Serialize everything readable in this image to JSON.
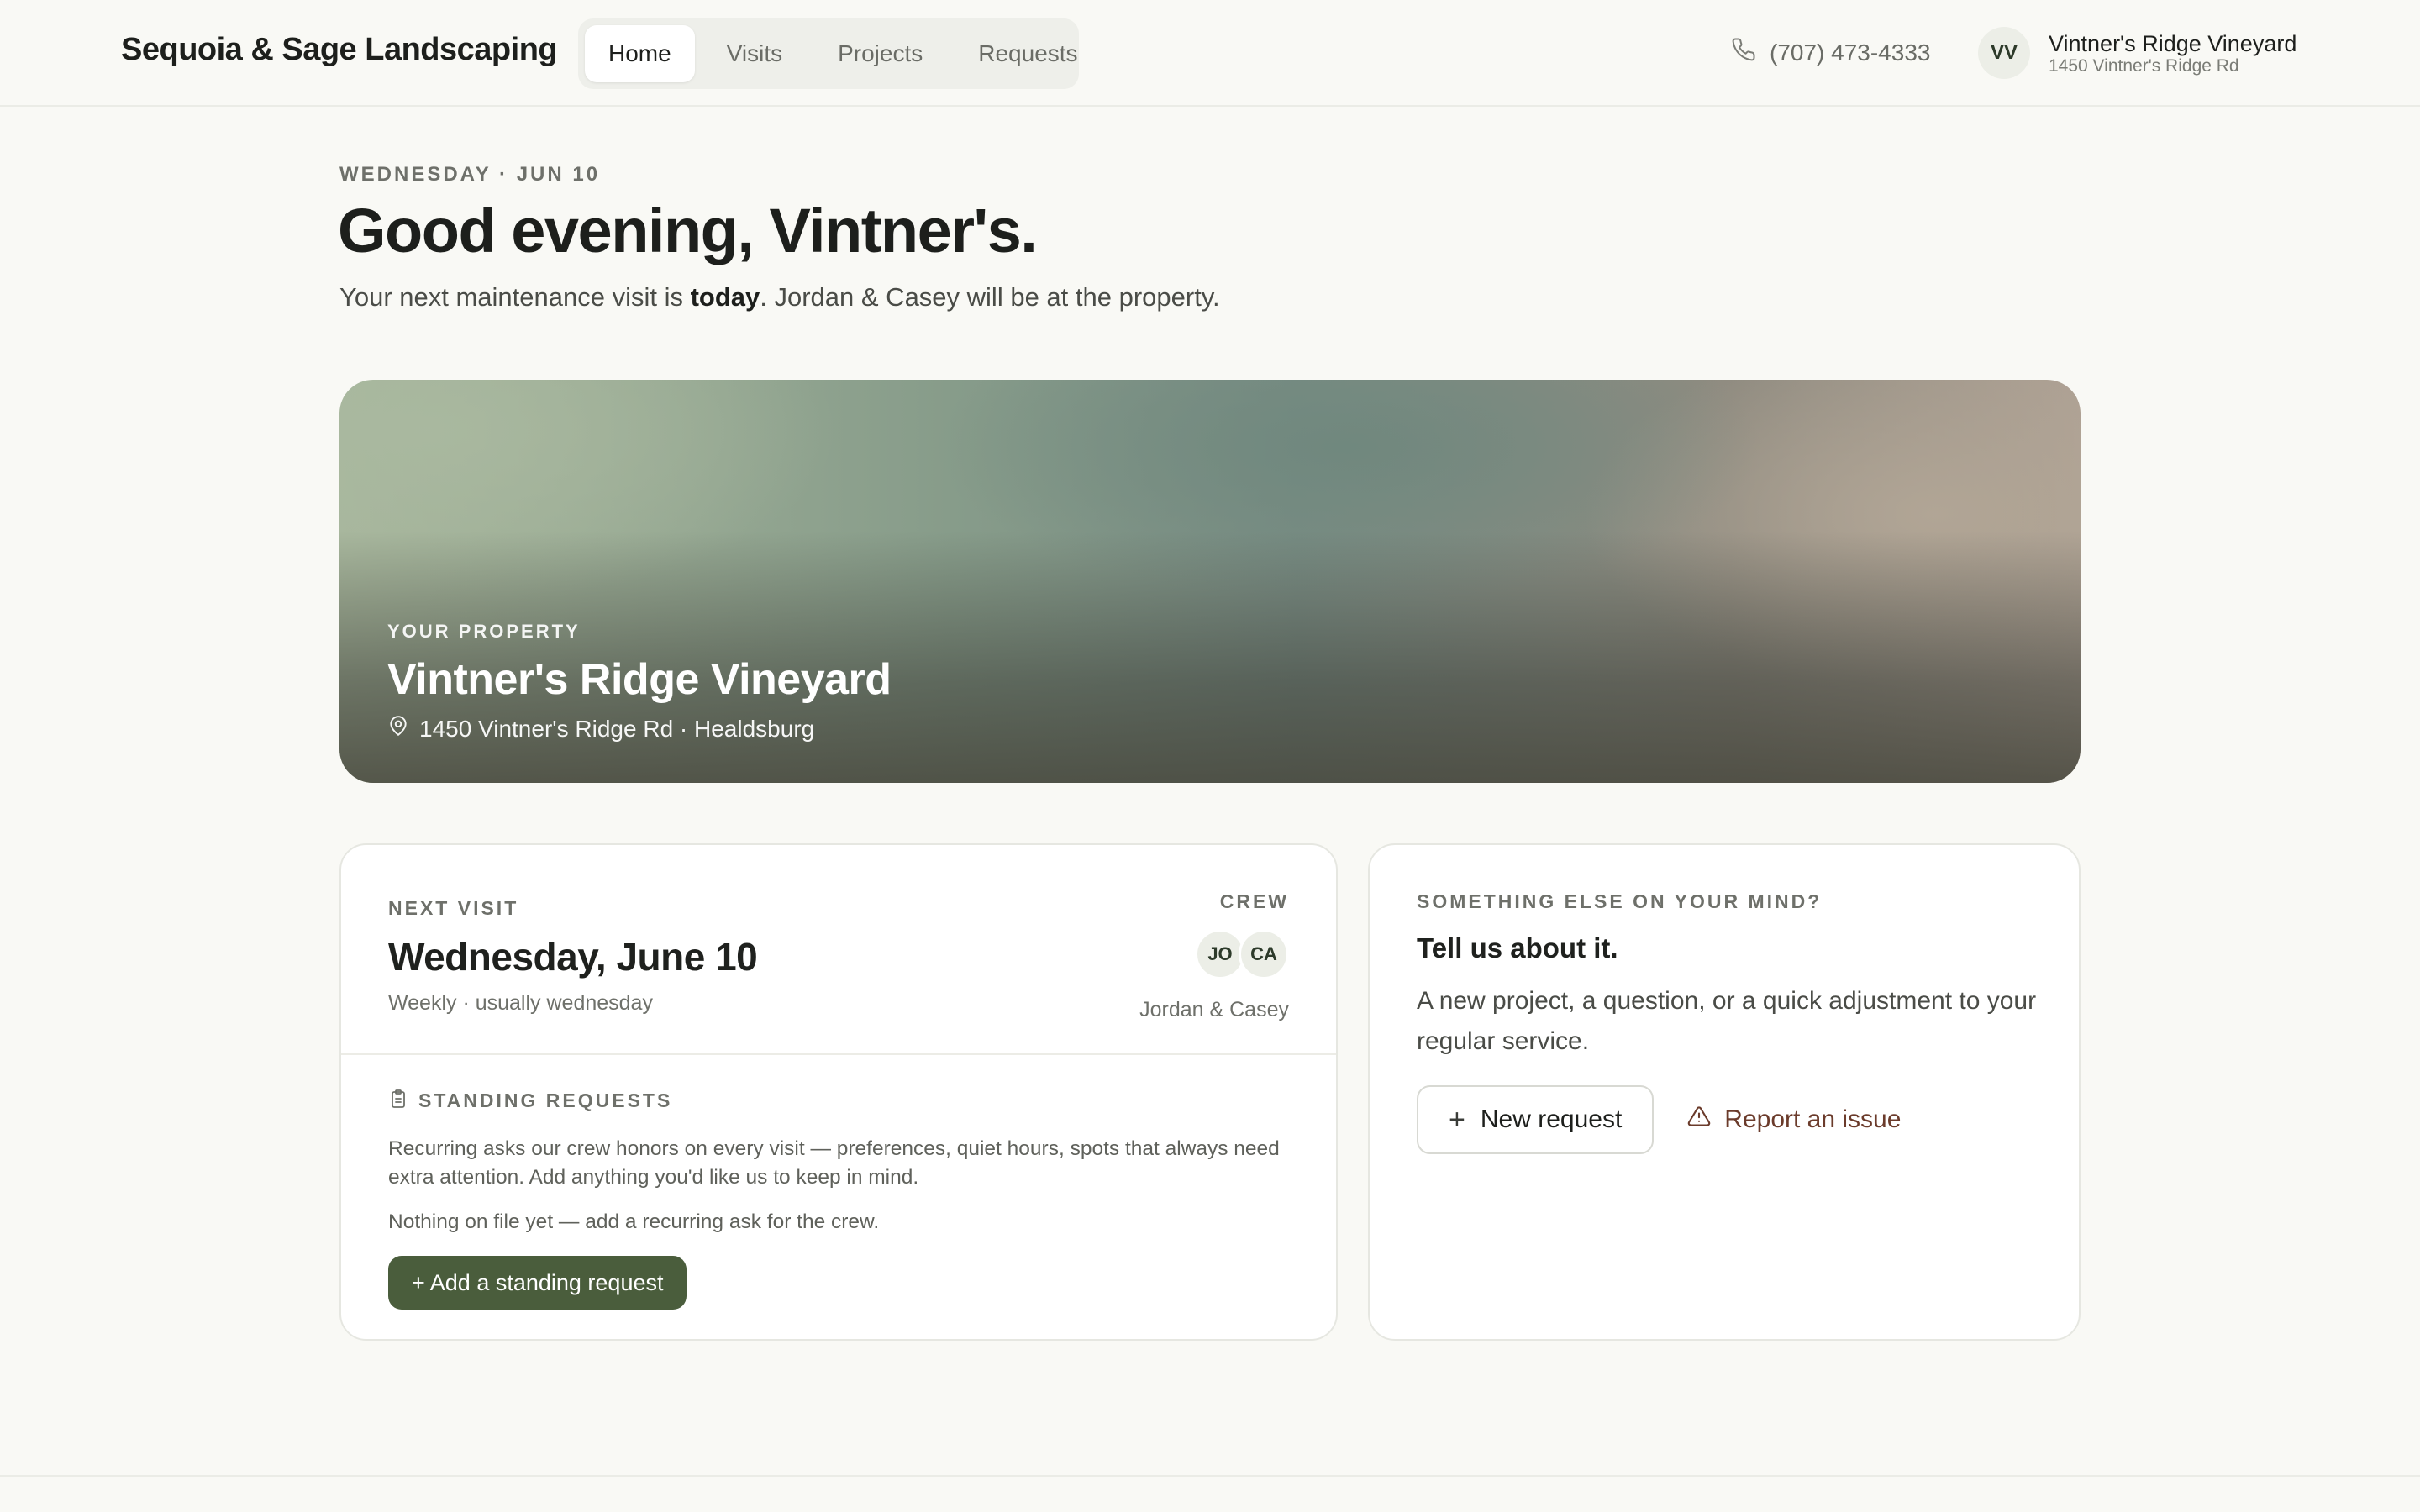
{
  "header": {
    "brand": "Sequoia & Sage Landscaping",
    "tabs": [
      {
        "label": "Home",
        "active": true
      },
      {
        "label": "Visits",
        "active": false
      },
      {
        "label": "Projects",
        "active": false
      },
      {
        "label": "Requests",
        "active": false
      }
    ],
    "phone": "(707) 473-4333",
    "account": {
      "initials": "VV",
      "name": "Vintner's Ridge Vineyard",
      "address": "1450 Vintner's Ridge Rd"
    }
  },
  "greeting": {
    "dateline": "WEDNESDAY · JUN 10",
    "title": "Good evening, Vintner's.",
    "sub_before": "Your next maintenance visit is ",
    "sub_bold": "today",
    "sub_after": ". Jordan & Casey will be at the property."
  },
  "hero": {
    "eyebrow": "YOUR PROPERTY",
    "title": "Vintner's Ridge Vineyard",
    "address": "1450 Vintner's Ridge Rd · Healdsburg"
  },
  "next_visit": {
    "eyebrow": "NEXT VISIT",
    "date": "Wednesday, June 10",
    "cadence": "Weekly · usually wednesday",
    "crew_label": "CREW",
    "crew_initials": [
      "JO",
      "CA"
    ],
    "crew_names": "Jordan & Casey",
    "standing": {
      "title": "STANDING REQUESTS",
      "description": "Recurring asks our crew honors on every visit — preferences, quiet hours, spots that always need extra attention. Add anything you'd like us to keep in mind.",
      "empty": "Nothing on file yet — add a recurring ask for the crew.",
      "button": "+ Add a standing request"
    }
  },
  "mind": {
    "eyebrow": "SOMETHING ELSE ON YOUR MIND?",
    "title": "Tell us about it.",
    "description": "A new project, a question, or a quick adjustment to your regular service.",
    "new_request": "New request",
    "report_issue": "Report an issue"
  },
  "colors": {
    "accent": "#4a5d3c",
    "warning_link": "#6b3b2b",
    "background": "#f9f9f5"
  }
}
